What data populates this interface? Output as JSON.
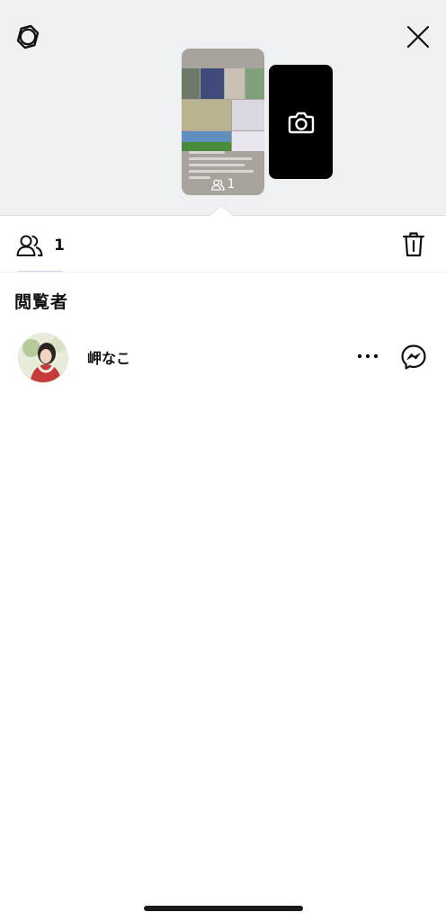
{
  "header": {
    "settings_icon": "settings-gear-icon",
    "close_icon": "close-x-icon"
  },
  "story": {
    "viewer_count": "1",
    "viewers_icon": "people-icon"
  },
  "camera_card": {
    "icon": "camera-icon"
  },
  "tabs": {
    "viewers_count": "1",
    "viewers_icon": "people-icon",
    "delete_icon": "trash-icon"
  },
  "section": {
    "title": "閲覧者"
  },
  "viewers": [
    {
      "name": "岬なこ",
      "more_icon": "more-dots-icon",
      "message_icon": "messenger-icon"
    }
  ],
  "colors": {
    "top_background": "#eff0f2",
    "accent_underline": "#c9d6ea",
    "camera_card": "#000000"
  }
}
